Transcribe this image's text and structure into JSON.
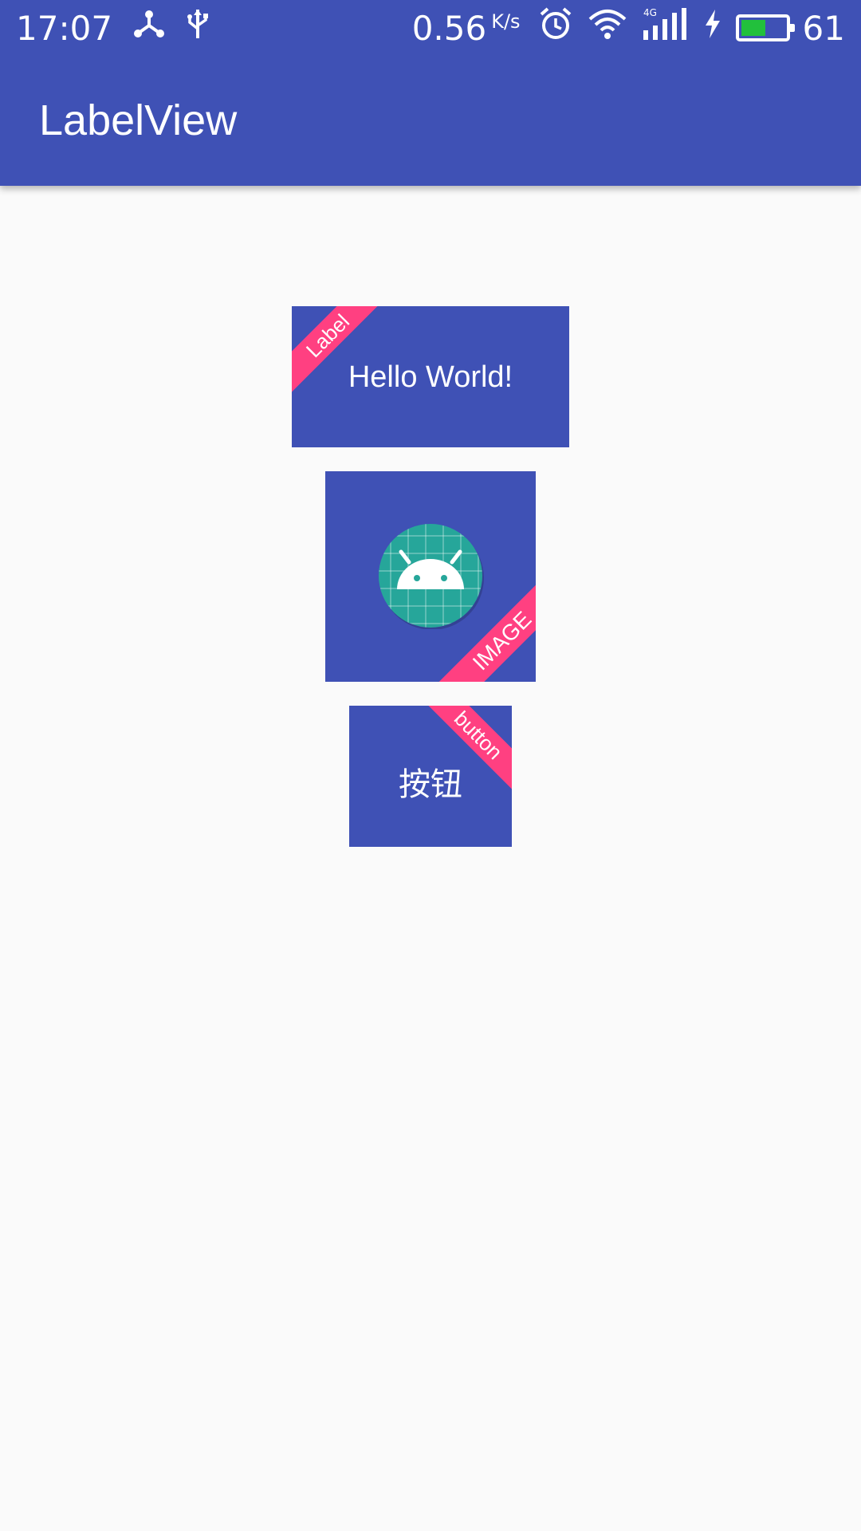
{
  "status_bar": {
    "time": "17:07",
    "net_speed": "0.56",
    "net_speed_unit": "K/s",
    "network_type": "4G",
    "battery_level": "61",
    "battery_percent": 61,
    "icons": [
      "share-icon",
      "usb-icon",
      "alarm-icon",
      "wifi-icon",
      "signal-icon",
      "charging-icon",
      "battery-icon"
    ]
  },
  "app_bar": {
    "title": "LabelView"
  },
  "colors": {
    "primary": "#3f51b5",
    "accent": "#ff4081",
    "background": "#fafafa",
    "battery": "#22c03c"
  },
  "labels": {
    "text_view": {
      "text": "Hello World!",
      "label": "Label"
    },
    "image_view": {
      "icon": "android-icon",
      "label": "IMAGE"
    },
    "button_view": {
      "text": "按钮",
      "label": "button"
    }
  }
}
